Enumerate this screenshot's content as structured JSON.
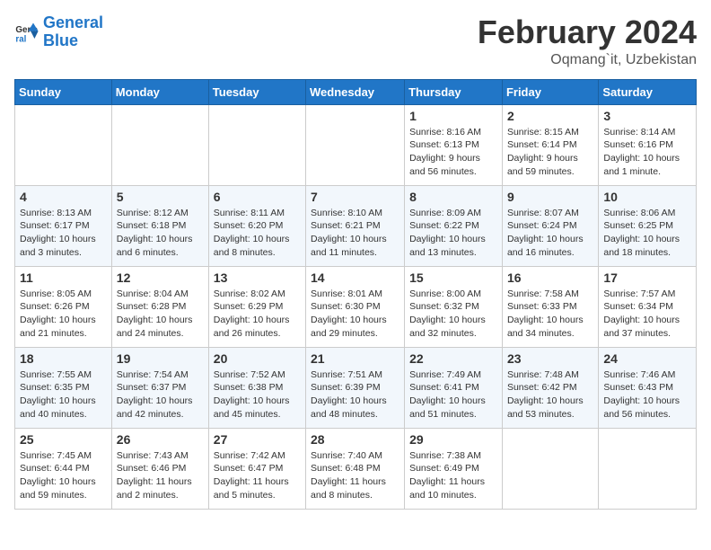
{
  "header": {
    "logo_line1": "General",
    "logo_line2": "Blue",
    "month": "February 2024",
    "location": "Oqmang`it, Uzbekistan"
  },
  "days_of_week": [
    "Sunday",
    "Monday",
    "Tuesday",
    "Wednesday",
    "Thursday",
    "Friday",
    "Saturday"
  ],
  "weeks": [
    [
      {
        "day": "",
        "info": ""
      },
      {
        "day": "",
        "info": ""
      },
      {
        "day": "",
        "info": ""
      },
      {
        "day": "",
        "info": ""
      },
      {
        "day": "1",
        "info": "Sunrise: 8:16 AM\nSunset: 6:13 PM\nDaylight: 9 hours\nand 56 minutes."
      },
      {
        "day": "2",
        "info": "Sunrise: 8:15 AM\nSunset: 6:14 PM\nDaylight: 9 hours\nand 59 minutes."
      },
      {
        "day": "3",
        "info": "Sunrise: 8:14 AM\nSunset: 6:16 PM\nDaylight: 10 hours\nand 1 minute."
      }
    ],
    [
      {
        "day": "4",
        "info": "Sunrise: 8:13 AM\nSunset: 6:17 PM\nDaylight: 10 hours\nand 3 minutes."
      },
      {
        "day": "5",
        "info": "Sunrise: 8:12 AM\nSunset: 6:18 PM\nDaylight: 10 hours\nand 6 minutes."
      },
      {
        "day": "6",
        "info": "Sunrise: 8:11 AM\nSunset: 6:20 PM\nDaylight: 10 hours\nand 8 minutes."
      },
      {
        "day": "7",
        "info": "Sunrise: 8:10 AM\nSunset: 6:21 PM\nDaylight: 10 hours\nand 11 minutes."
      },
      {
        "day": "8",
        "info": "Sunrise: 8:09 AM\nSunset: 6:22 PM\nDaylight: 10 hours\nand 13 minutes."
      },
      {
        "day": "9",
        "info": "Sunrise: 8:07 AM\nSunset: 6:24 PM\nDaylight: 10 hours\nand 16 minutes."
      },
      {
        "day": "10",
        "info": "Sunrise: 8:06 AM\nSunset: 6:25 PM\nDaylight: 10 hours\nand 18 minutes."
      }
    ],
    [
      {
        "day": "11",
        "info": "Sunrise: 8:05 AM\nSunset: 6:26 PM\nDaylight: 10 hours\nand 21 minutes."
      },
      {
        "day": "12",
        "info": "Sunrise: 8:04 AM\nSunset: 6:28 PM\nDaylight: 10 hours\nand 24 minutes."
      },
      {
        "day": "13",
        "info": "Sunrise: 8:02 AM\nSunset: 6:29 PM\nDaylight: 10 hours\nand 26 minutes."
      },
      {
        "day": "14",
        "info": "Sunrise: 8:01 AM\nSunset: 6:30 PM\nDaylight: 10 hours\nand 29 minutes."
      },
      {
        "day": "15",
        "info": "Sunrise: 8:00 AM\nSunset: 6:32 PM\nDaylight: 10 hours\nand 32 minutes."
      },
      {
        "day": "16",
        "info": "Sunrise: 7:58 AM\nSunset: 6:33 PM\nDaylight: 10 hours\nand 34 minutes."
      },
      {
        "day": "17",
        "info": "Sunrise: 7:57 AM\nSunset: 6:34 PM\nDaylight: 10 hours\nand 37 minutes."
      }
    ],
    [
      {
        "day": "18",
        "info": "Sunrise: 7:55 AM\nSunset: 6:35 PM\nDaylight: 10 hours\nand 40 minutes."
      },
      {
        "day": "19",
        "info": "Sunrise: 7:54 AM\nSunset: 6:37 PM\nDaylight: 10 hours\nand 42 minutes."
      },
      {
        "day": "20",
        "info": "Sunrise: 7:52 AM\nSunset: 6:38 PM\nDaylight: 10 hours\nand 45 minutes."
      },
      {
        "day": "21",
        "info": "Sunrise: 7:51 AM\nSunset: 6:39 PM\nDaylight: 10 hours\nand 48 minutes."
      },
      {
        "day": "22",
        "info": "Sunrise: 7:49 AM\nSunset: 6:41 PM\nDaylight: 10 hours\nand 51 minutes."
      },
      {
        "day": "23",
        "info": "Sunrise: 7:48 AM\nSunset: 6:42 PM\nDaylight: 10 hours\nand 53 minutes."
      },
      {
        "day": "24",
        "info": "Sunrise: 7:46 AM\nSunset: 6:43 PM\nDaylight: 10 hours\nand 56 minutes."
      }
    ],
    [
      {
        "day": "25",
        "info": "Sunrise: 7:45 AM\nSunset: 6:44 PM\nDaylight: 10 hours\nand 59 minutes."
      },
      {
        "day": "26",
        "info": "Sunrise: 7:43 AM\nSunset: 6:46 PM\nDaylight: 11 hours\nand 2 minutes."
      },
      {
        "day": "27",
        "info": "Sunrise: 7:42 AM\nSunset: 6:47 PM\nDaylight: 11 hours\nand 5 minutes."
      },
      {
        "day": "28",
        "info": "Sunrise: 7:40 AM\nSunset: 6:48 PM\nDaylight: 11 hours\nand 8 minutes."
      },
      {
        "day": "29",
        "info": "Sunrise: 7:38 AM\nSunset: 6:49 PM\nDaylight: 11 hours\nand 10 minutes."
      },
      {
        "day": "",
        "info": ""
      },
      {
        "day": "",
        "info": ""
      }
    ]
  ]
}
